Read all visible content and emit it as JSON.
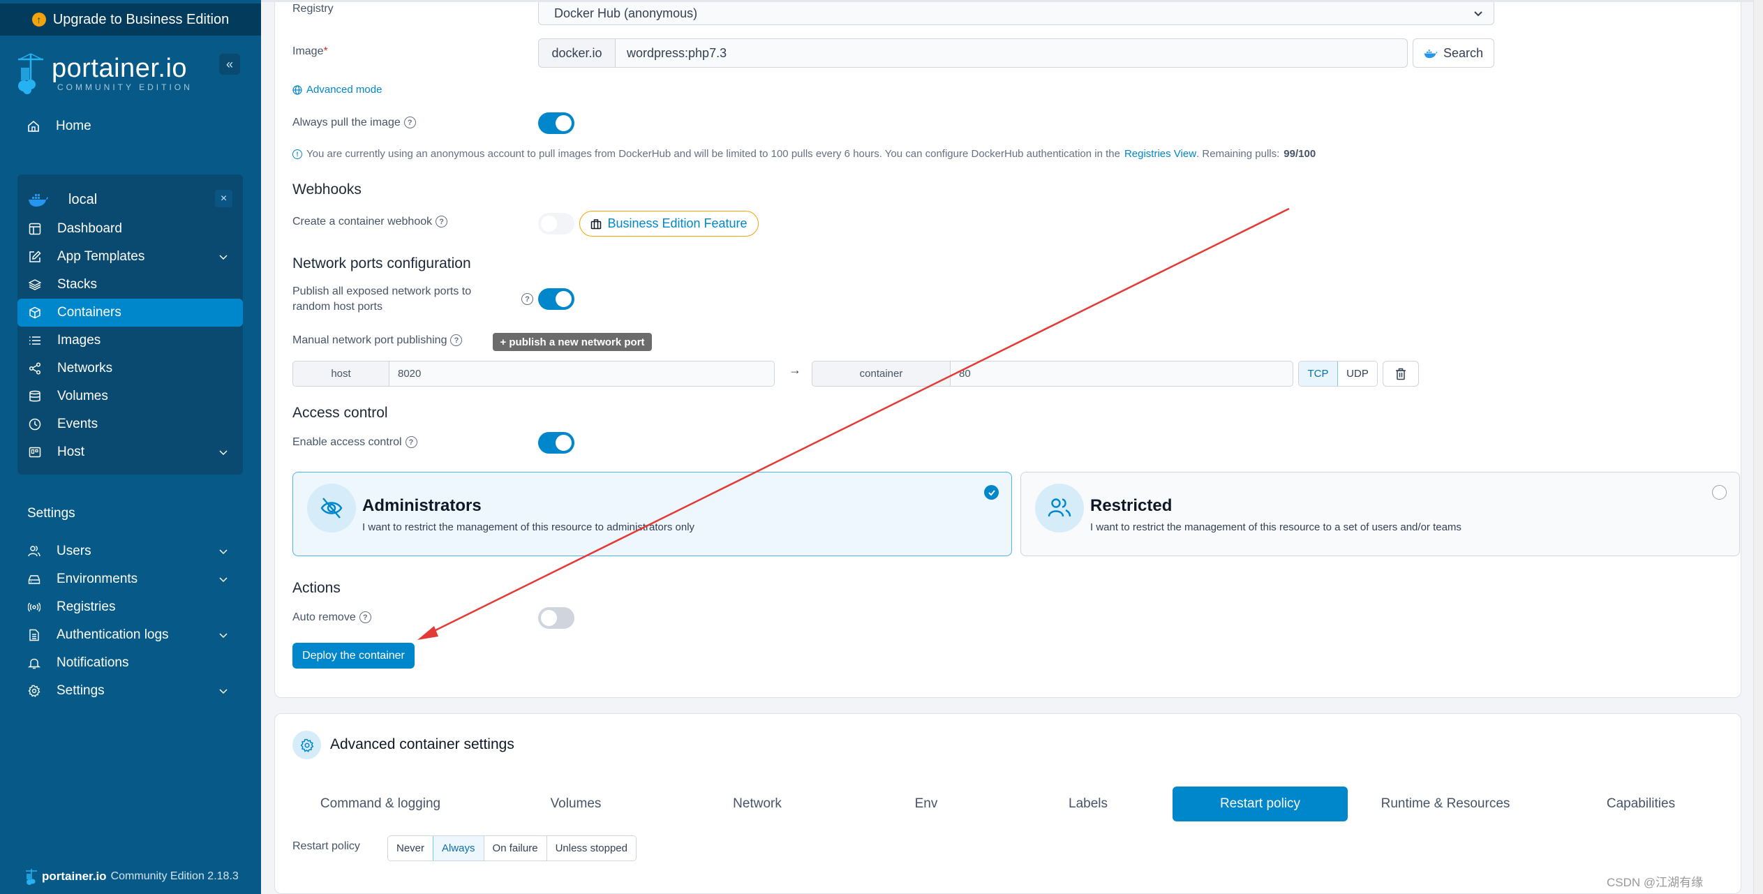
{
  "colors": {
    "accent": "#0086cb",
    "sidebar": "#075a87",
    "sidebar_dark": "#023b5c",
    "warning": "#f3a30c",
    "annotation": "#e53935"
  },
  "sidebar": {
    "upgrade_label": "Upgrade to Business Edition",
    "logo_name": "portainer.io",
    "logo_sub": "COMMUNITY EDITION",
    "collapse_icon": "«",
    "home_label": "Home",
    "environment": {
      "name": "local",
      "close": "×"
    },
    "env_items": [
      {
        "label": "Dashboard",
        "icon": "dashboard-icon",
        "expandable": false,
        "active": false
      },
      {
        "label": "App Templates",
        "icon": "edit-icon",
        "expandable": true,
        "active": false
      },
      {
        "label": "Stacks",
        "icon": "layers-icon",
        "expandable": false,
        "active": false
      },
      {
        "label": "Containers",
        "icon": "box-icon",
        "expandable": false,
        "active": true
      },
      {
        "label": "Images",
        "icon": "list-icon",
        "expandable": false,
        "active": false
      },
      {
        "label": "Networks",
        "icon": "share-icon",
        "expandable": false,
        "active": false
      },
      {
        "label": "Volumes",
        "icon": "database-icon",
        "expandable": false,
        "active": false
      },
      {
        "label": "Events",
        "icon": "clock-icon",
        "expandable": false,
        "active": false
      },
      {
        "label": "Host",
        "icon": "host-icon",
        "expandable": true,
        "active": false
      }
    ],
    "settings_title": "Settings",
    "settings_items": [
      {
        "label": "Users",
        "icon": "users-icon",
        "expandable": true
      },
      {
        "label": "Environments",
        "icon": "hard-drive-icon",
        "expandable": true
      },
      {
        "label": "Registries",
        "icon": "radio-icon",
        "expandable": false
      },
      {
        "label": "Authentication logs",
        "icon": "file-text-icon",
        "expandable": true
      },
      {
        "label": "Notifications",
        "icon": "bell-icon",
        "expandable": false
      },
      {
        "label": "Settings",
        "icon": "gear-icon",
        "expandable": true
      }
    ],
    "footer": {
      "brand": "portainer.io",
      "edition": "Community Edition 2.18.3"
    }
  },
  "form": {
    "registry_label": "Registry",
    "registry_value": "Docker Hub (anonymous)",
    "image_label": "Image",
    "image_required": "*",
    "image_prefix": "docker.io",
    "image_value": "wordpress:php7.3",
    "search_label": "Search",
    "advanced_mode": "Advanced mode",
    "always_pull_label": "Always pull the image",
    "always_pull": true,
    "info": {
      "text": "You are currently using an anonymous account to pull images from DockerHub and will be limited to 100 pulls every 6 hours. You can configure DockerHub authentication in the",
      "link": "Registries View",
      "remaining_label": ". Remaining pulls:",
      "remaining_value": "99/100"
    },
    "webhooks_title": "Webhooks",
    "webhook_label": "Create a container webhook",
    "webhook_enabled": false,
    "be_feature": "Business Edition Feature",
    "network_title": "Network ports configuration",
    "publish_all_label_1": "Publish all exposed network ports to",
    "publish_all_label_2": "random host ports",
    "publish_all": true,
    "manual_label": "Manual network port publishing",
    "publish_new": "+ publish a new network port",
    "port_mapping": {
      "host_label": "host",
      "host_value": "8020",
      "container_label": "container",
      "container_value": "80",
      "protocols": [
        "TCP",
        "UDP"
      ],
      "selected_protocol": "TCP"
    },
    "access_title": "Access control",
    "access_label": "Enable access control",
    "access_enabled": true,
    "access_options": [
      {
        "title": "Administrators",
        "desc": "I want to restrict the management of this resource to administrators only",
        "selected": true
      },
      {
        "title": "Restricted",
        "desc": "I want to restrict the management of this resource to a set of users and/or teams",
        "selected": false
      }
    ],
    "actions_title": "Actions",
    "auto_remove_label": "Auto remove",
    "auto_remove": false,
    "deploy_label": "Deploy the container"
  },
  "advanced": {
    "title": "Advanced container settings",
    "tabs": [
      "Command & logging",
      "Volumes",
      "Network",
      "Env",
      "Labels",
      "Restart policy",
      "Runtime & Resources",
      "Capabilities"
    ],
    "active_tab": "Restart policy",
    "restart_policy_label": "Restart policy",
    "restart_options": [
      "Never",
      "Always",
      "On failure",
      "Unless stopped"
    ],
    "restart_selected": "Always"
  },
  "watermark": "CSDN @江湖有缘"
}
